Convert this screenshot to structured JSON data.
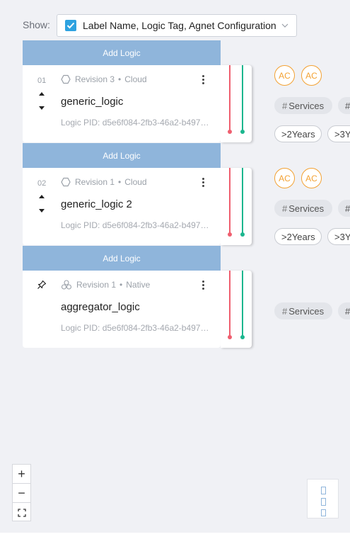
{
  "show": {
    "label": "Show:",
    "selected": "Label Name, Logic Tag, Agnet Configuration"
  },
  "add_logic_label": "Add Logic",
  "cards": [
    {
      "number": "01",
      "revision": "Revision 3",
      "env": "Cloud",
      "name": "generic_logic",
      "pid": "Logic PID: d5e6f084-2fb3-46a2-b497-…",
      "avatars": [
        "AC",
        "AC"
      ],
      "tags": [
        "Services",
        "#"
      ],
      "ages": [
        ">2Years",
        ">3Y"
      ]
    },
    {
      "number": "02",
      "revision": "Revision 1",
      "env": "Cloud",
      "name": "generic_logic 2",
      "pid": "Logic PID: d5e6f084-2fb3-46a2-b497-…",
      "avatars": [
        "AC",
        "AC"
      ],
      "tags": [
        "Services",
        "#"
      ],
      "ages": [
        ">2Years",
        ">3Y"
      ]
    },
    {
      "number": "",
      "revision": "Revision 1",
      "env": "Native",
      "name": "aggregator_logic",
      "pid": "Logic PID: d5e6f084-2fb3-46a2-b497-…",
      "avatars": [],
      "tags": [
        "Services",
        "#"
      ],
      "ages": []
    }
  ],
  "separator": "•",
  "zoom": {
    "in": "+",
    "out": "−"
  },
  "colors": {
    "accent": "#2ea2e0",
    "add_bar": "#8fb5db",
    "red_track": "#ef5f6f",
    "green_track": "#1bb68e",
    "avatar": "#f3a233"
  }
}
